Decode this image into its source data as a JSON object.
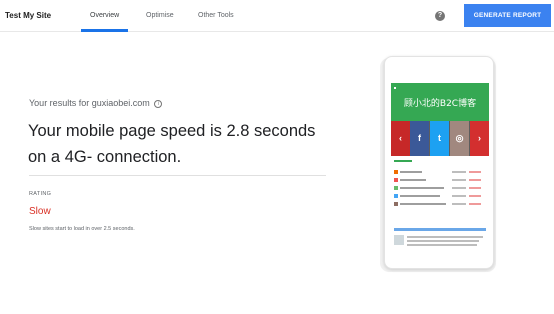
{
  "header": {
    "site_name": "Test My Site",
    "tabs": [
      {
        "label": "Overview",
        "active": true
      },
      {
        "label": "Optimise",
        "active": false
      },
      {
        "label": "Other Tools",
        "active": false
      }
    ],
    "help_icon": "help-icon",
    "generate_button": "GENERATE REPORT",
    "accent_color": "#1a73e8"
  },
  "results": {
    "results_for": "Your results for guxiaobei.com",
    "info_icon": "info-icon",
    "headline": "Your mobile page speed is 2.8 seconds on a 4G- connection.",
    "rating_label": "RATING",
    "rating_value": "Slow",
    "rating_color": "#d93025",
    "rating_description": "Slow sites start to load in over 2.5 seconds."
  },
  "preview": {
    "banner_title": "顾小北的B2C博客",
    "banner_color": "#35a853"
  }
}
